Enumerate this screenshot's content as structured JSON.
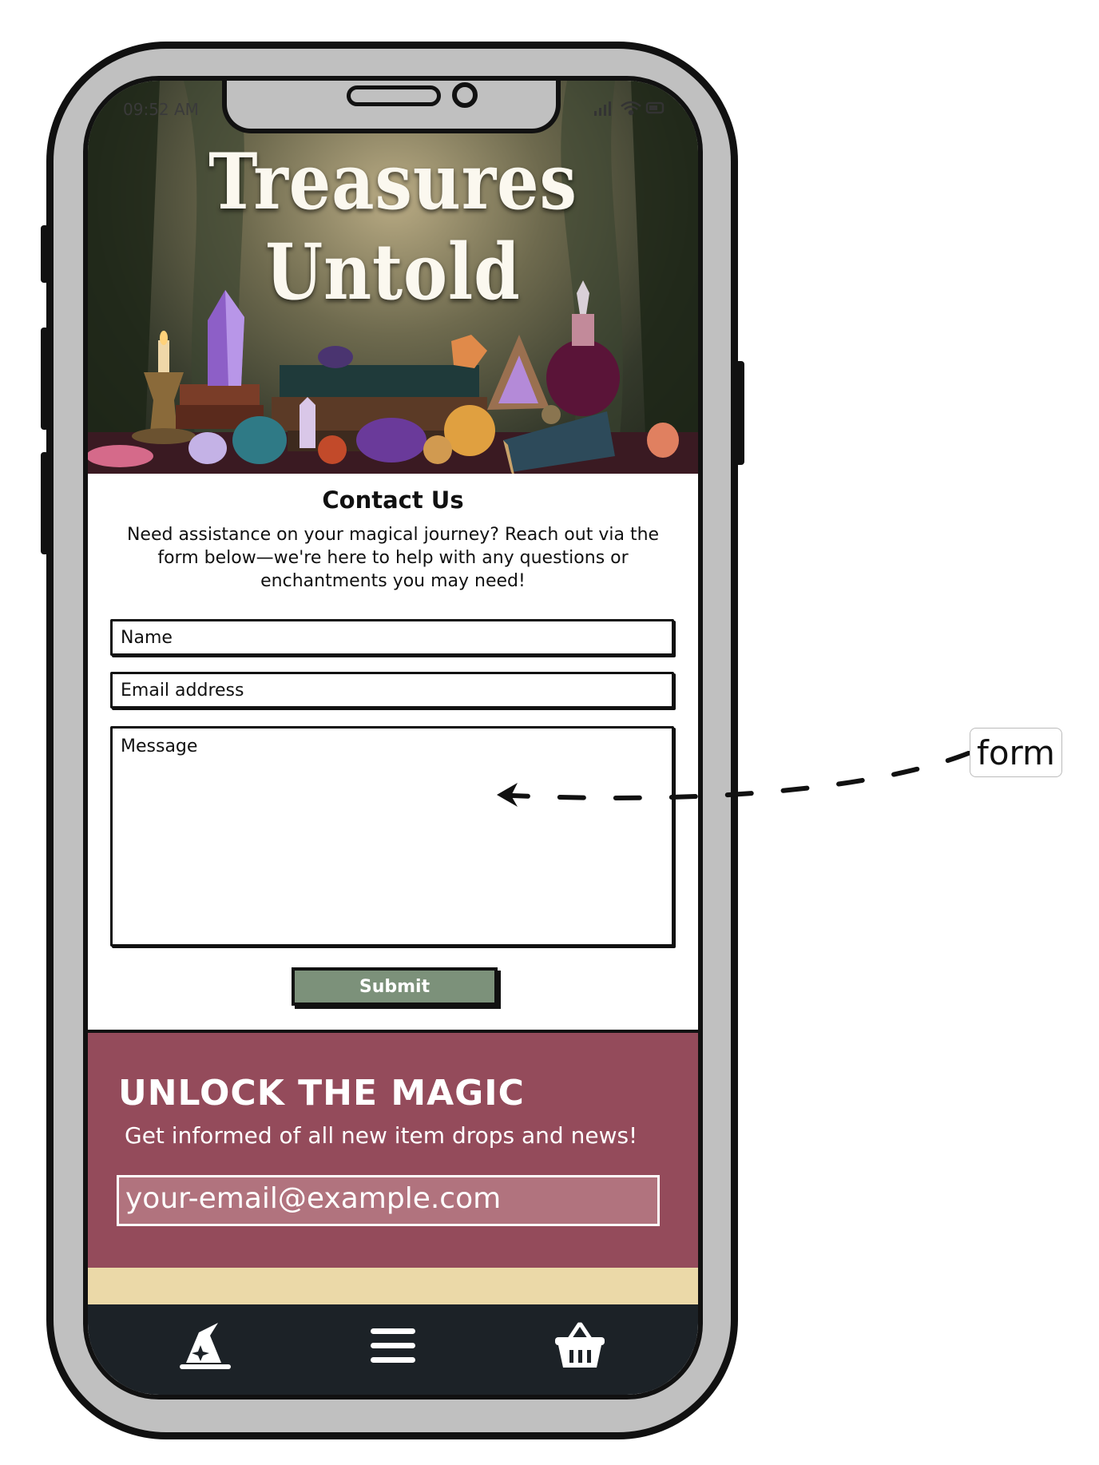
{
  "status_bar": {
    "time": "09:52 AM"
  },
  "hero": {
    "title": "Treasures Untold"
  },
  "contact": {
    "title": "Contact Us",
    "description": "Need assistance on your magical journey? Reach out via the form below—we're here to help with any questions or enchantments you may need!",
    "name_placeholder": "Name",
    "email_placeholder": "Email address",
    "message_placeholder": "Message",
    "submit_label": "Submit"
  },
  "newsletter": {
    "title": "UNLOCK THE MAGIC",
    "subtitle": "Get informed of all new item drops and news!",
    "email_placeholder": "your-email@example.com"
  },
  "bottom_nav": {
    "items": [
      {
        "icon": "wizard-hat-icon"
      },
      {
        "icon": "menu-icon"
      },
      {
        "icon": "basket-icon"
      }
    ]
  },
  "annotation": {
    "label": "form"
  },
  "colors": {
    "submit_button": "#7c917a",
    "newsletter_bg": "#944b5b",
    "footer_strip": "#ebd9a8",
    "nav_bg": "#1c2227",
    "phone_frame": "#c0c0c0"
  }
}
